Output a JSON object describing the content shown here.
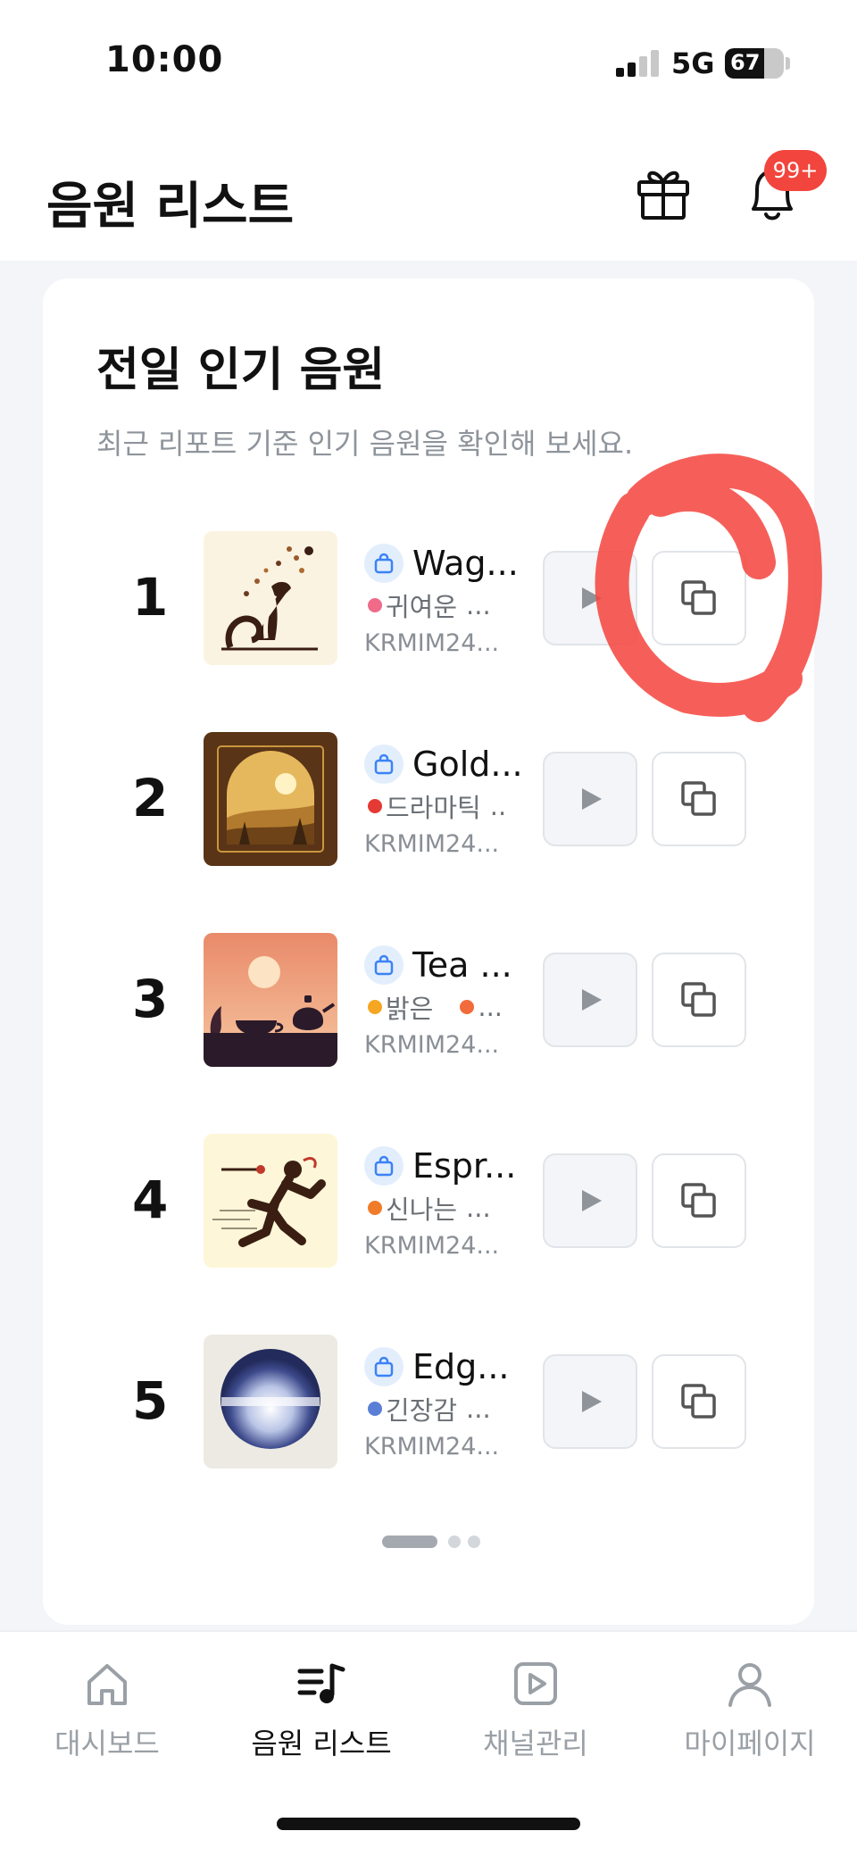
{
  "status_bar": {
    "time": "10:00",
    "network": "5G",
    "battery": "67"
  },
  "header": {
    "title": "음원 리스트",
    "notification_badge": "99+"
  },
  "section": {
    "title": "전일 인기 음원",
    "subtitle": "최근 리포트 기준 인기 음원을 확인해 보세요."
  },
  "tracks": [
    {
      "rank": "1",
      "title": "Wag...",
      "tag": "귀여운",
      "tag_color": "#f06a8a",
      "second_dot": false,
      "more": "...",
      "code": "KRMIM24..."
    },
    {
      "rank": "2",
      "title": "Gold...",
      "tag": "드라마틱",
      "tag_color": "#e53935",
      "second_dot": false,
      "more": "..",
      "code": "KRMIM24..."
    },
    {
      "rank": "3",
      "title": "Tea ...",
      "tag": "밝은",
      "tag_color": "#f5a623",
      "second_dot": true,
      "second_dot_color": "#f26b3a",
      "more": "...",
      "code": "KRMIM24..."
    },
    {
      "rank": "4",
      "title": "Espr...",
      "tag": "신나는",
      "tag_color": "#f07c2a",
      "second_dot": false,
      "more": "...",
      "code": "KRMIM24..."
    },
    {
      "rank": "5",
      "title": "Edg...",
      "tag": "긴장감",
      "tag_color": "#5b7fd6",
      "second_dot": false,
      "more": "...",
      "code": "KRMIM24..."
    }
  ],
  "pager": {
    "pages": 3,
    "current": 1
  },
  "bottom_nav": [
    {
      "label": "대시보드",
      "icon": "home-icon",
      "active": false
    },
    {
      "label": "음원 리스트",
      "icon": "music-list-icon",
      "active": true
    },
    {
      "label": "채널관리",
      "icon": "play-square-icon",
      "active": false
    },
    {
      "label": "마이페이지",
      "icon": "person-icon",
      "active": false
    }
  ]
}
